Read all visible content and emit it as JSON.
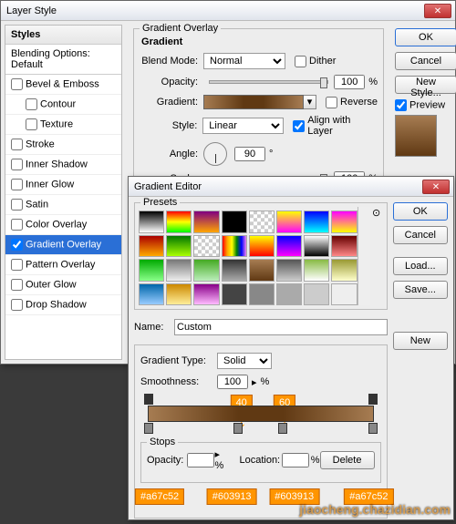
{
  "ls": {
    "title": "Layer Style",
    "sidebar_hdr": "Styles",
    "blending": "Blending Options: Default",
    "items": [
      "Bevel & Emboss",
      "Contour",
      "Texture",
      "Stroke",
      "Inner Shadow",
      "Inner Glow",
      "Satin",
      "Color Overlay",
      "Gradient Overlay",
      "Pattern Overlay",
      "Outer Glow",
      "Drop Shadow"
    ],
    "group_title": "Gradient Overlay",
    "sub_title": "Gradient",
    "blend_mode_lab": "Blend Mode:",
    "blend_mode_val": "Normal",
    "dither": "Dither",
    "opacity_lab": "Opacity:",
    "opacity_val": "100",
    "pct": "%",
    "gradient_lab": "Gradient:",
    "reverse": "Reverse",
    "style_lab": "Style:",
    "style_val": "Linear",
    "align": "Align with Layer",
    "angle_lab": "Angle:",
    "angle_val": "90",
    "deg": "°",
    "scale_lab": "Scale:",
    "scale_val": "100",
    "ok": "OK",
    "cancel": "Cancel",
    "new_style": "New Style...",
    "preview": "Preview"
  },
  "ge": {
    "title": "Gradient Editor",
    "presets_lab": "Presets",
    "ok": "OK",
    "cancel": "Cancel",
    "load": "Load...",
    "save": "Save...",
    "name_lab": "Name:",
    "name_val": "Custom",
    "new": "New",
    "type_lab": "Gradient Type:",
    "type_val": "Solid",
    "smooth_lab": "Smoothness:",
    "smooth_val": "100",
    "pct": "%",
    "stops_lab": "Stops",
    "opacity_lab": "Opacity:",
    "location_lab": "Location:",
    "delete": "Delete",
    "tag40": "40",
    "tag60": "60",
    "tagA": "#a67c52",
    "tagB": "#603913",
    "tagC": "#603913",
    "tagD": "#a67c52"
  },
  "watermark": "jiaocheng.chazidian.com",
  "preset_colors": [
    "linear-gradient(#000,#fff)",
    "linear-gradient(#f00,#ff0,#0f0)",
    "linear-gradient(#800080,#ffa500)",
    "#000",
    "repeating-conic-gradient(#ccc 0 25%,#fff 0 50%) 0/8px 8px",
    "linear-gradient(#ff0,#f0f)",
    "linear-gradient(#00f,#0ff)",
    "linear-gradient(#f0f,#ff0)",
    "linear-gradient(#a00,#fa0)",
    "linear-gradient(#070,#af0)",
    "repeating-conic-gradient(#ccc 0 25%,#fff 0 50%) 0/8px 8px",
    "linear-gradient(90deg,red,orange,yellow,green,blue,violet)",
    "linear-gradient(#ff0,#f00)",
    "linear-gradient(#00f,#f0f)",
    "linear-gradient(#fff,#000)",
    "linear-gradient(#600,#f88)",
    "linear-gradient(#0a0,#8f8)",
    "linear-gradient(#777,#eee)",
    "linear-gradient(#4a2,#beb)",
    "linear-gradient(#333,#aaa)",
    "linear-gradient(#a67c52,#603913)",
    "linear-gradient(#555,#ccc)",
    "linear-gradient(#8b4,#fff)",
    "linear-gradient(#993,#ffc)",
    "linear-gradient(#06a,#9cf)",
    "linear-gradient(#c80,#fe9)",
    "linear-gradient(#808,#fbf)",
    "#444",
    "#888",
    "#aaa",
    "#ccc",
    "#eee"
  ]
}
